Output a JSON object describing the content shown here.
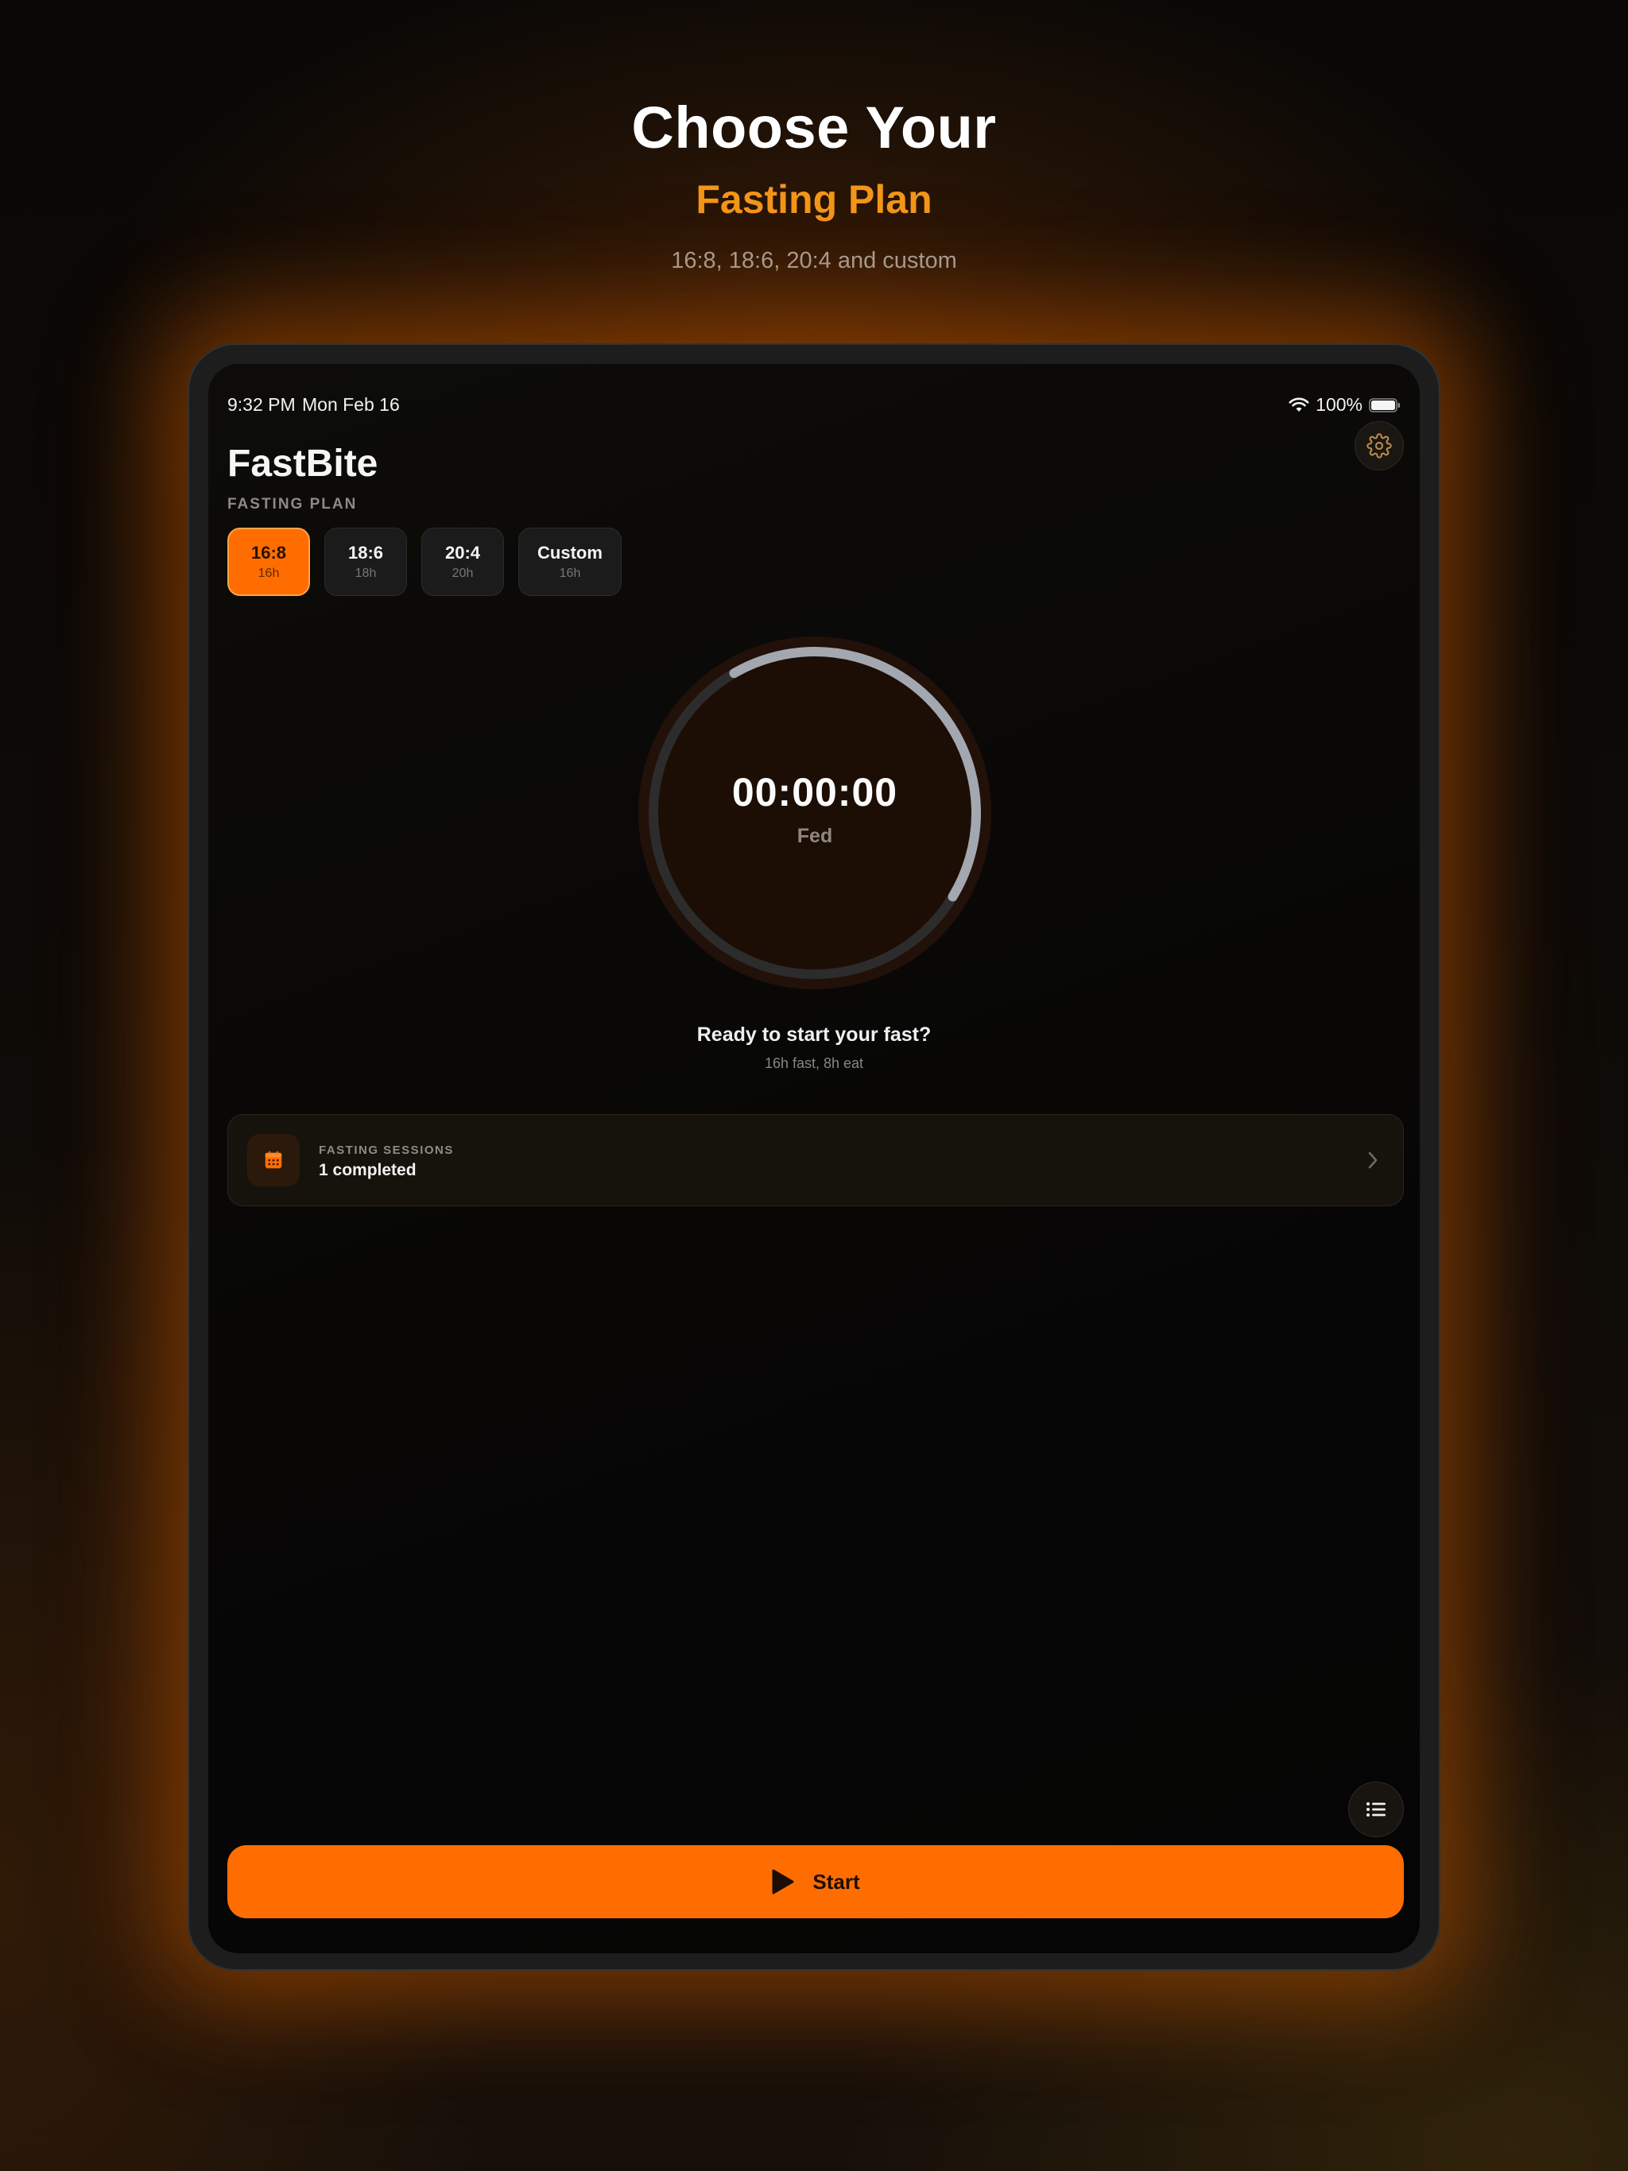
{
  "hero": {
    "title": "Choose Your",
    "subtitle": "Fasting Plan",
    "tagline": "16:8, 18:6, 20:4 and custom"
  },
  "status_bar": {
    "time": "9:32 PM",
    "date": "Mon Feb 16",
    "battery": "100%"
  },
  "app": {
    "title": "FastBite",
    "settings_icon": "gear-icon"
  },
  "plan_section": {
    "label": "FASTING PLAN",
    "plans": [
      {
        "name": "16:8",
        "hours": "16h",
        "selected": true
      },
      {
        "name": "18:6",
        "hours": "18h",
        "selected": false
      },
      {
        "name": "20:4",
        "hours": "20h",
        "selected": false
      },
      {
        "name": "Custom",
        "hours": "16h",
        "selected": false
      }
    ]
  },
  "timer": {
    "value": "00:00:00",
    "state": "Fed",
    "progress": 0.42
  },
  "prompt": {
    "title": "Ready to start your fast?",
    "subtitle": "16h fast, 8h eat"
  },
  "sessions": {
    "label": "FASTING SESSIONS",
    "value": "1 completed",
    "icon": "calendar-icon"
  },
  "actions": {
    "log_icon": "list-icon",
    "start_label": "Start",
    "start_icon": "play-icon"
  },
  "colors": {
    "accent": "#ff6d00",
    "hero_accent": "#f39619",
    "ring_progress": "#a3a7b0",
    "ring_track": "#2c2c2c"
  }
}
